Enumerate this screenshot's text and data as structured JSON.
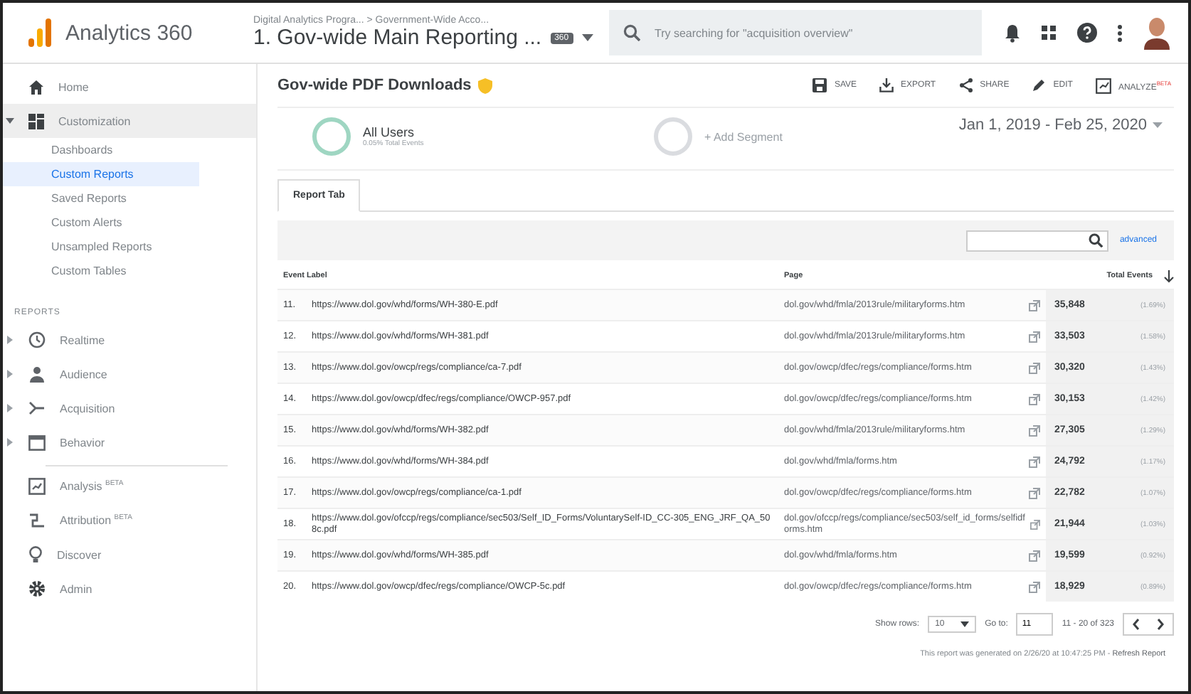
{
  "header": {
    "product": "Analytics 360",
    "breadcrumb": "Digital Analytics Progra... > Government-Wide Acco...",
    "view": "1. Gov-wide Main Reporting ...",
    "badge": "360",
    "search": {
      "placeholder": "Try searching for \"acquisition overview\""
    }
  },
  "sidebar": {
    "top": [
      {
        "label": "Home",
        "selected": false
      },
      {
        "label": "Customization",
        "selected": true,
        "expanded": true,
        "children": [
          {
            "label": "Dashboards",
            "selected": false
          },
          {
            "label": "Custom Reports",
            "selected": true
          },
          {
            "label": "Saved Reports",
            "selected": false
          },
          {
            "label": "Custom Alerts",
            "selected": false
          },
          {
            "label": "Unsampled Reports",
            "selected": false
          },
          {
            "label": "Custom Tables",
            "selected": false
          }
        ]
      }
    ],
    "section": "REPORTS",
    "reports": [
      {
        "label": "Realtime"
      },
      {
        "label": "Audience"
      },
      {
        "label": "Acquisition"
      },
      {
        "label": "Behavior"
      }
    ],
    "bottom": [
      {
        "label": "Analysis $^{BETA}$"
      },
      {
        "label": "Attribution $^{BETA}$"
      },
      {
        "label": "Discover"
      },
      {
        "label": "Admin"
      }
    ]
  },
  "report": {
    "title": "Gov-wide PDF Downloads",
    "actions": [
      "SAVE",
      "EXPORT",
      "SHARE",
      "EDIT",
      "ANALYZE$^{BETA}$"
    ],
    "segments": [
      {
        "name": "All Users",
        "sub": "0.05% Total Events"
      },
      {
        "name": "+ Add Segment"
      }
    ],
    "date_range": "Jan 1, 2019 - Feb 25, 2020",
    "tabs": [
      {
        "label": "Report Tab",
        "selected": true
      }
    ],
    "advanced": "advanced",
    "table": {
      "columns": [
        "Event Label",
        "Page",
        "Total Events"
      ],
      "rows": [
        {
          "n": "11.",
          "label": "https://www.dol.gov/whd/forms/WH-380-E.pdf",
          "page": "dol.gov/whd/fmla/2013rule/militaryforms.htm",
          "total": "35,848",
          "pct": "(1.69%)"
        },
        {
          "n": "12.",
          "label": "https://www.dol.gov/whd/forms/WH-381.pdf",
          "page": "dol.gov/whd/fmla/2013rule/militaryforms.htm",
          "total": "33,503",
          "pct": "(1.58%)"
        },
        {
          "n": "13.",
          "label": "https://www.dol.gov/owcp/regs/compliance/ca-7.pdf",
          "page": "dol.gov/owcp/dfec/regs/compliance/forms.htm",
          "total": "30,320",
          "pct": "(1.43%)"
        },
        {
          "n": "14.",
          "label": "https://www.dol.gov/owcp/dfec/regs/compliance/OWCP-957.pdf",
          "page": "dol.gov/owcp/dfec/regs/compliance/forms.htm",
          "total": "30,153",
          "pct": "(1.42%)"
        },
        {
          "n": "15.",
          "label": "https://www.dol.gov/whd/forms/WH-382.pdf",
          "page": "dol.gov/whd/fmla/2013rule/militaryforms.htm",
          "total": "27,305",
          "pct": "(1.29%)"
        },
        {
          "n": "16.",
          "label": "https://www.dol.gov/whd/forms/WH-384.pdf",
          "page": "dol.gov/whd/fmla/forms.htm",
          "total": "24,792",
          "pct": "(1.17%)"
        },
        {
          "n": "17.",
          "label": "https://www.dol.gov/owcp/regs/compliance/ca-1.pdf",
          "page": "dol.gov/owcp/dfec/regs/compliance/forms.htm",
          "total": "22,782",
          "pct": "(1.07%)"
        },
        {
          "n": "18.",
          "label": "https://www.dol.gov/ofccp/regs/compliance/sec503/Self_ID_Forms/VoluntarySelf-ID_CC-305_ENG_JRF_QA_508c.pdf",
          "page": "dol.gov/ofccp/regs/compliance/sec503/self_id_forms/selfidforms.htm",
          "total": "21,944",
          "pct": "(1.03%)"
        },
        {
          "n": "19.",
          "label": "https://www.dol.gov/whd/forms/WH-385.pdf",
          "page": "dol.gov/whd/fmla/forms.htm",
          "total": "19,599",
          "pct": "(0.92%)"
        },
        {
          "n": "20.",
          "label": "https://www.dol.gov/owcp/dfec/regs/compliance/OWCP-5c.pdf",
          "page": "dol.gov/owcp/dfec/regs/compliance/forms.htm",
          "total": "18,929",
          "pct": "(0.89%)"
        }
      ]
    },
    "pagination": {
      "show_rows_label": "Show rows:",
      "rows": "10",
      "goto_label": "Go to:",
      "goto": "11",
      "range": "11 - 20 of 323"
    },
    "note": "This report was generated on 2/26/20 at 10:47:25 PM -",
    "refresh": "Refresh Report"
  }
}
